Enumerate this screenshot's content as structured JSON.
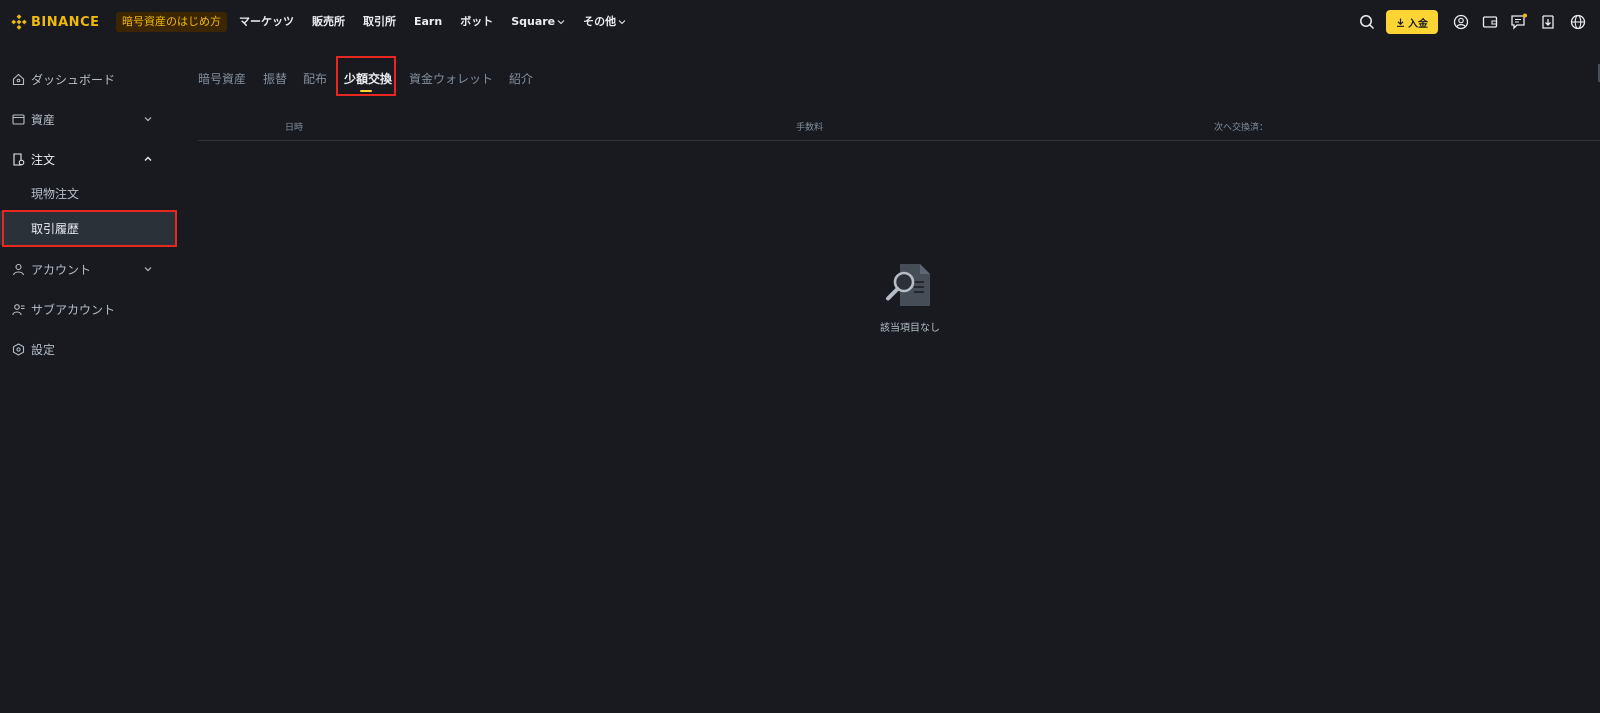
{
  "header": {
    "brand": "BINANCE",
    "promo": "暗号資産のはじめ方",
    "nav": [
      {
        "label": "マーケッツ",
        "has_chevron": false
      },
      {
        "label": "販売所",
        "has_chevron": false
      },
      {
        "label": "取引所",
        "has_chevron": false
      },
      {
        "label": "Earn",
        "has_chevron": false
      },
      {
        "label": "ボット",
        "has_chevron": false
      },
      {
        "label": "Square",
        "has_chevron": true
      },
      {
        "label": "その他",
        "has_chevron": true
      }
    ],
    "deposit_label": "入金",
    "icons": [
      "search-icon",
      "user-icon",
      "wallet-icon",
      "message-icon",
      "download-icon",
      "globe-icon"
    ]
  },
  "sidebar": {
    "items": [
      {
        "label": "ダッシュボード",
        "icon": "home-icon"
      },
      {
        "label": "資産",
        "icon": "wallet-icon",
        "expandable": true,
        "expanded": false
      },
      {
        "label": "注文",
        "icon": "order-icon",
        "expandable": true,
        "expanded": true
      },
      {
        "label": "アカウント",
        "icon": "user-icon",
        "expandable": true,
        "expanded": false
      },
      {
        "label": "サブアカウント",
        "icon": "sub-account-icon"
      },
      {
        "label": "設定",
        "icon": "settings-icon"
      }
    ],
    "sub_items": [
      {
        "label": "現物注文",
        "selected": false
      },
      {
        "label": "取引履歴",
        "selected": true
      }
    ]
  },
  "tabs": [
    {
      "label": "暗号資産",
      "active": false
    },
    {
      "label": "振替",
      "active": false
    },
    {
      "label": "配布",
      "active": false
    },
    {
      "label": "少額交換",
      "active": true
    },
    {
      "label": "資金ウォレット",
      "active": false
    },
    {
      "label": "紹介",
      "active": false
    }
  ],
  "table": {
    "columns": [
      "日時",
      "手数料",
      "次へ交換済："
    ]
  },
  "empty_state": {
    "text": "該当項目なし",
    "icon": "no-results-icon"
  },
  "colors": {
    "background": "#181a20",
    "accent": "#fcd535",
    "brand": "#f0b90b",
    "highlight": "#e8271f",
    "muted": "#848e9c"
  }
}
